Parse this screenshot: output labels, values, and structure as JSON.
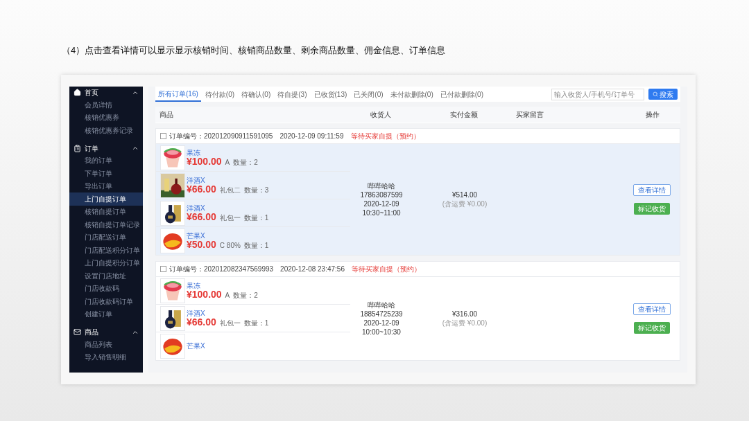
{
  "caption": "（4）点击查看详情可以显示显示核销时间、核销商品数量、剩余商品数量、佣金信息、订单信息",
  "sidebar": {
    "groups": [
      {
        "kind": "home",
        "label": "首页",
        "expanded": true,
        "items": [
          {
            "label": "会员详情",
            "selected": false
          },
          {
            "label": "核销优惠券",
            "selected": false
          },
          {
            "label": "核销优惠券记录",
            "selected": false
          }
        ]
      },
      {
        "kind": "order",
        "label": "订单",
        "expanded": true,
        "items": [
          {
            "label": "我的订单",
            "selected": false
          },
          {
            "label": "下单订单",
            "selected": false
          },
          {
            "label": "导出订单",
            "selected": false
          },
          {
            "label": "上门自提订单",
            "selected": true
          },
          {
            "label": "核销自提订单",
            "selected": false
          },
          {
            "label": "核销自提订单记录",
            "selected": false
          },
          {
            "label": "门店配送订单",
            "selected": false
          },
          {
            "label": "门店配送积分订单",
            "selected": false
          },
          {
            "label": "上门自提积分订单",
            "selected": false
          },
          {
            "label": "设置门店地址",
            "selected": false
          },
          {
            "label": "门店收款码",
            "selected": false
          },
          {
            "label": "门店收款码订单",
            "selected": false
          },
          {
            "label": "创建订单",
            "selected": false
          }
        ]
      },
      {
        "kind": "goods",
        "label": "商品",
        "expanded": true,
        "items": [
          {
            "label": "商品列表",
            "selected": false
          },
          {
            "label": "导入销售明细",
            "selected": false
          }
        ]
      }
    ]
  },
  "tabs": [
    {
      "label": "所有订单(16)",
      "selected": true
    },
    {
      "label": "待付款(0)",
      "selected": false
    },
    {
      "label": "待确认(0)",
      "selected": false
    },
    {
      "label": "待自提(3)",
      "selected": false
    },
    {
      "label": "已收货(13)",
      "selected": false
    },
    {
      "label": "已关闭(0)",
      "selected": false
    },
    {
      "label": "未付款删除(0)",
      "selected": false
    },
    {
      "label": "已付款删除(0)",
      "selected": false
    }
  ],
  "search": {
    "placeholder": "输入收货人/手机号/订单号",
    "button": "搜索"
  },
  "columns": [
    "商品",
    "收货人",
    "实付金额",
    "买家留言",
    "操作"
  ],
  "orders": [
    {
      "selected": true,
      "checked": false,
      "number_label": "订单编号：",
      "number": "202012090911591095",
      "time": "2020-12-09 09:11:59",
      "status": "等待买家自提（预约）",
      "items": [
        {
          "name": "果冻",
          "price": "¥100.00",
          "spec": "A",
          "qty": "数量：2"
        },
        {
          "name": "洋酒X",
          "price": "¥66.00",
          "spec": "礼包二",
          "qty": "数量：3"
        },
        {
          "name": "洋酒X",
          "price": "¥66.00",
          "spec": "礼包一",
          "qty": "数量：1"
        },
        {
          "name": "芒果X",
          "price": "¥50.00",
          "spec": "C 80%",
          "qty": "数量：1"
        }
      ],
      "receiver": [
        "哔哔哈哈",
        "17863087599",
        "2020-12-09",
        "10:30~11:00"
      ],
      "amount": "¥514.00",
      "freight": "(含运费 ¥0.00)",
      "actions": [
        "查看详情",
        "标记收货"
      ]
    },
    {
      "selected": false,
      "checked": false,
      "number_label": "订单编号：",
      "number": "202012082347569993",
      "time": "2020-12-08 23:47:56",
      "status": "等待买家自提（预约）",
      "items": [
        {
          "name": "果冻",
          "price": "¥100.00",
          "spec": "A",
          "qty": "数量：2"
        },
        {
          "name": "洋酒X",
          "price": "¥66.00",
          "spec": "礼包一",
          "qty": "数量：1"
        },
        {
          "name": "芒果X"
        }
      ],
      "receiver": [
        "哔哔哈哈",
        "18854725239",
        "2020-12-09",
        "10:00~10:30"
      ],
      "amount": "¥316.00",
      "freight": "(含运费 ¥0.00)",
      "actions": [
        "查看详情",
        "标记收货"
      ]
    }
  ]
}
